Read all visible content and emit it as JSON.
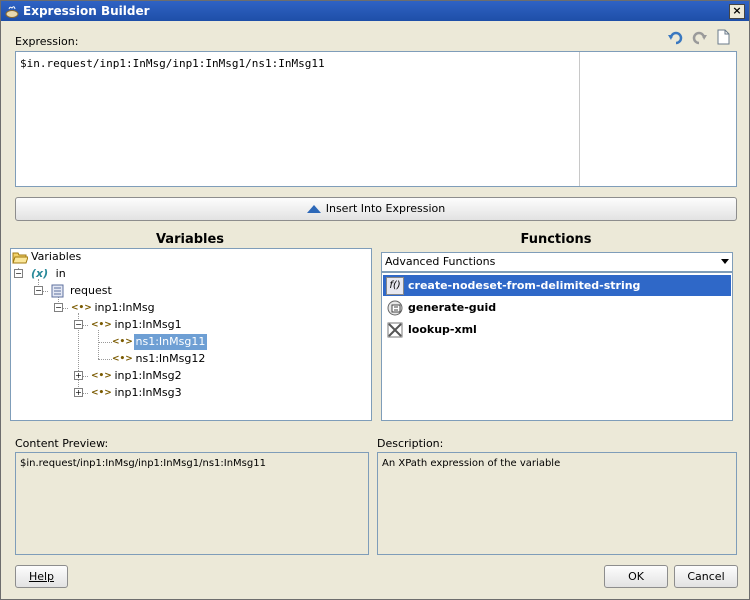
{
  "window": {
    "title": "Expression Builder",
    "close_label": "×"
  },
  "expression": {
    "label": "Expression:",
    "value": "$in.request/inp1:InMsg/inp1:InMsg1/ns1:InMsg11"
  },
  "insert_button": {
    "label": "Insert Into Expression"
  },
  "variables": {
    "title": "Variables",
    "tree": {
      "root": "Variables",
      "in": "in",
      "in_badge": "(x)",
      "request": "request",
      "inmsg": "inp1:InMsg",
      "inmsg1": "inp1:InMsg1",
      "inmsg11": "ns1:InMsg11",
      "inmsg12": "ns1:InMsg12",
      "inmsg2": "inp1:InMsg2",
      "inmsg3": "inp1:InMsg3",
      "tag_glyph": "<•>"
    }
  },
  "functions": {
    "title": "Functions",
    "selected_category": "Advanced Functions",
    "items": [
      {
        "name": "create-nodeset-from-delimited-string",
        "icon": "f()"
      },
      {
        "name": "generate-guid",
        "icon": "guid-icon"
      },
      {
        "name": "lookup-xml",
        "icon": "xml-icon"
      }
    ]
  },
  "content_preview": {
    "label": "Content Preview:",
    "value": "$in.request/inp1:InMsg/inp1:InMsg1/ns1:InMsg11"
  },
  "description": {
    "label": "Description:",
    "value": "An XPath expression of the variable"
  },
  "buttons": {
    "help": "Help",
    "ok": "OK",
    "cancel": "Cancel"
  },
  "colors": {
    "titlebar": "#2f63c4",
    "selection": "#2f68c8",
    "tree_selection": "#6e9fd4"
  }
}
